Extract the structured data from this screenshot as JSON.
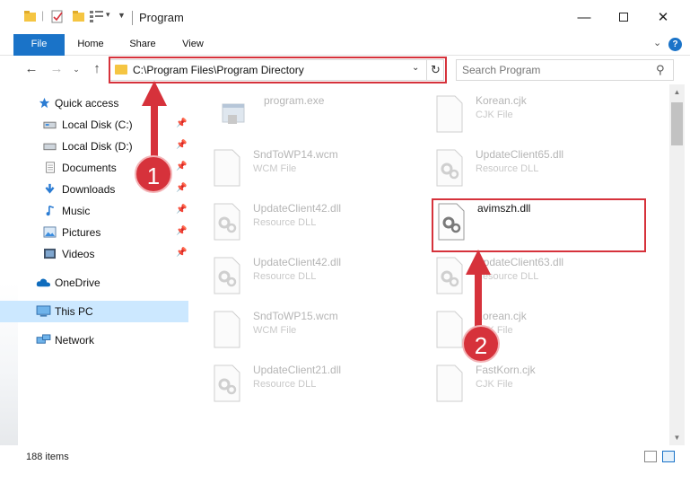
{
  "window": {
    "title": "Program"
  },
  "ribbon": {
    "tabs": [
      "File",
      "Home",
      "Share",
      "View"
    ],
    "help": "?"
  },
  "address": {
    "path": "C:\\Program Files\\Program Directory"
  },
  "search": {
    "placeholder": "Search Program"
  },
  "sidebar": {
    "items": [
      {
        "label": "Quick access",
        "icon": "star-icon"
      },
      {
        "label": "Local Disk (C:)",
        "icon": "drive-icon"
      },
      {
        "label": "Local Disk (D:)",
        "icon": "drive-icon"
      },
      {
        "label": "Documents",
        "icon": "documents-icon"
      },
      {
        "label": "Downloads",
        "icon": "download-icon"
      },
      {
        "label": "Music",
        "icon": "music-icon"
      },
      {
        "label": "Pictures",
        "icon": "pictures-icon"
      },
      {
        "label": "Videos",
        "icon": "videos-icon"
      },
      {
        "label": "OneDrive",
        "icon": "cloud-icon"
      },
      {
        "label": "This PC",
        "icon": "computer-icon"
      },
      {
        "label": "Network",
        "icon": "network-icon"
      }
    ]
  },
  "files": [
    {
      "name": "program.exe",
      "type": "",
      "icon": "exe-icon"
    },
    {
      "name": "Korean.cjk",
      "type": "CJK File",
      "icon": "doc-icon"
    },
    {
      "name": "SndToWP14.wcm",
      "type": "WCM File",
      "icon": "doc-icon"
    },
    {
      "name": "UpdateClient65.dll",
      "type": "Resource DLL",
      "icon": "gear-doc-icon"
    },
    {
      "name": "UpdateClient42.dll",
      "type": "Resource DLL",
      "icon": "gear-doc-icon"
    },
    {
      "name": "avimszh.dll",
      "type": "",
      "icon": "gear-doc-icon"
    },
    {
      "name": "UpdateClient42.dll",
      "type": "Resource DLL",
      "icon": "gear-doc-icon"
    },
    {
      "name": "UpdateClient63.dll",
      "type": "Resource DLL",
      "icon": "gear-doc-icon"
    },
    {
      "name": "SndToWP15.wcm",
      "type": "WCM File",
      "icon": "doc-icon"
    },
    {
      "name": "Korean.cjk",
      "type": "CJK File",
      "icon": "doc-icon"
    },
    {
      "name": "UpdateClient21.dll",
      "type": "Resource DLL",
      "icon": "gear-doc-icon"
    },
    {
      "name": "FastKorn.cjk",
      "type": "CJK File",
      "icon": "doc-icon"
    }
  ],
  "status": {
    "count": "188 items"
  },
  "callouts": [
    "1",
    "2"
  ],
  "colors": {
    "accent": "#1a73c8",
    "highlight": "#d6323b",
    "selected": "#cce8ff"
  }
}
